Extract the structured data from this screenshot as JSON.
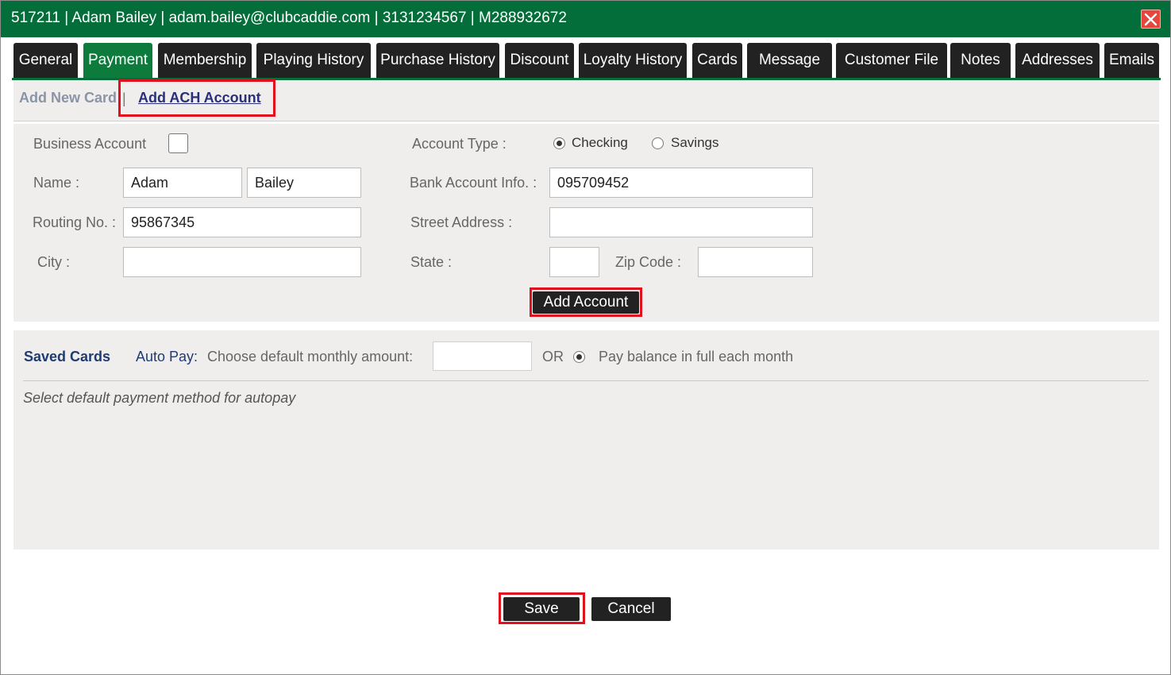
{
  "window": {
    "title": "517211 | Adam Bailey | adam.bailey@clubcaddie.com | 3131234567 | M288932672",
    "close_icon": "close-icon"
  },
  "tabs": [
    {
      "label": "General",
      "active": false
    },
    {
      "label": "Payment",
      "active": true
    },
    {
      "label": "Membership",
      "active": false
    },
    {
      "label": "Playing History",
      "active": false
    },
    {
      "label": "Purchase History",
      "active": false
    },
    {
      "label": "Discount",
      "active": false
    },
    {
      "label": "Loyalty History",
      "active": false
    },
    {
      "label": "Cards",
      "active": false
    },
    {
      "label": "Message",
      "active": false
    },
    {
      "label": "Customer File",
      "active": false
    },
    {
      "label": "Notes",
      "active": false
    },
    {
      "label": "Addresses",
      "active": false
    },
    {
      "label": "Emails",
      "active": false
    }
  ],
  "subnav": {
    "add_new_card": "Add New Card",
    "separator": "|",
    "add_ach_account": "Add ACH Account"
  },
  "ach_form": {
    "business_account_label": "Business Account",
    "business_account_checked": false,
    "name_label": "Name :",
    "first_name": "Adam",
    "last_name": "Bailey",
    "routing_label": "Routing No. :",
    "routing_value": "95867345",
    "city_label": "City :",
    "city_value": "",
    "account_type_label": "Account Type :",
    "account_type_options": [
      "Checking",
      "Savings"
    ],
    "account_type_selected": "Checking",
    "bank_info_label": "Bank Account Info. :",
    "bank_info_value": "095709452",
    "street_label": "Street Address :",
    "street_value": "",
    "state_label": "State :",
    "state_value": "",
    "zip_label": "Zip Code :",
    "zip_value": "",
    "add_account_button": "Add Account"
  },
  "saved_cards": {
    "title": "Saved Cards",
    "autopay_label": "Auto Pay:",
    "autopay_desc": "Choose default monthly amount:",
    "amount_value": "",
    "or_label": "OR",
    "pay_full_label": "Pay balance in full each month",
    "pay_full_selected": true,
    "hint": "Select default payment method for autopay"
  },
  "footer": {
    "save_button": "Save",
    "cancel_button": "Cancel"
  },
  "colors": {
    "titlebar": "#036e3a",
    "active_tab": "#0d7b3c",
    "tab": "#222222",
    "highlight": "#e0101f",
    "panel": "#efeeed"
  }
}
